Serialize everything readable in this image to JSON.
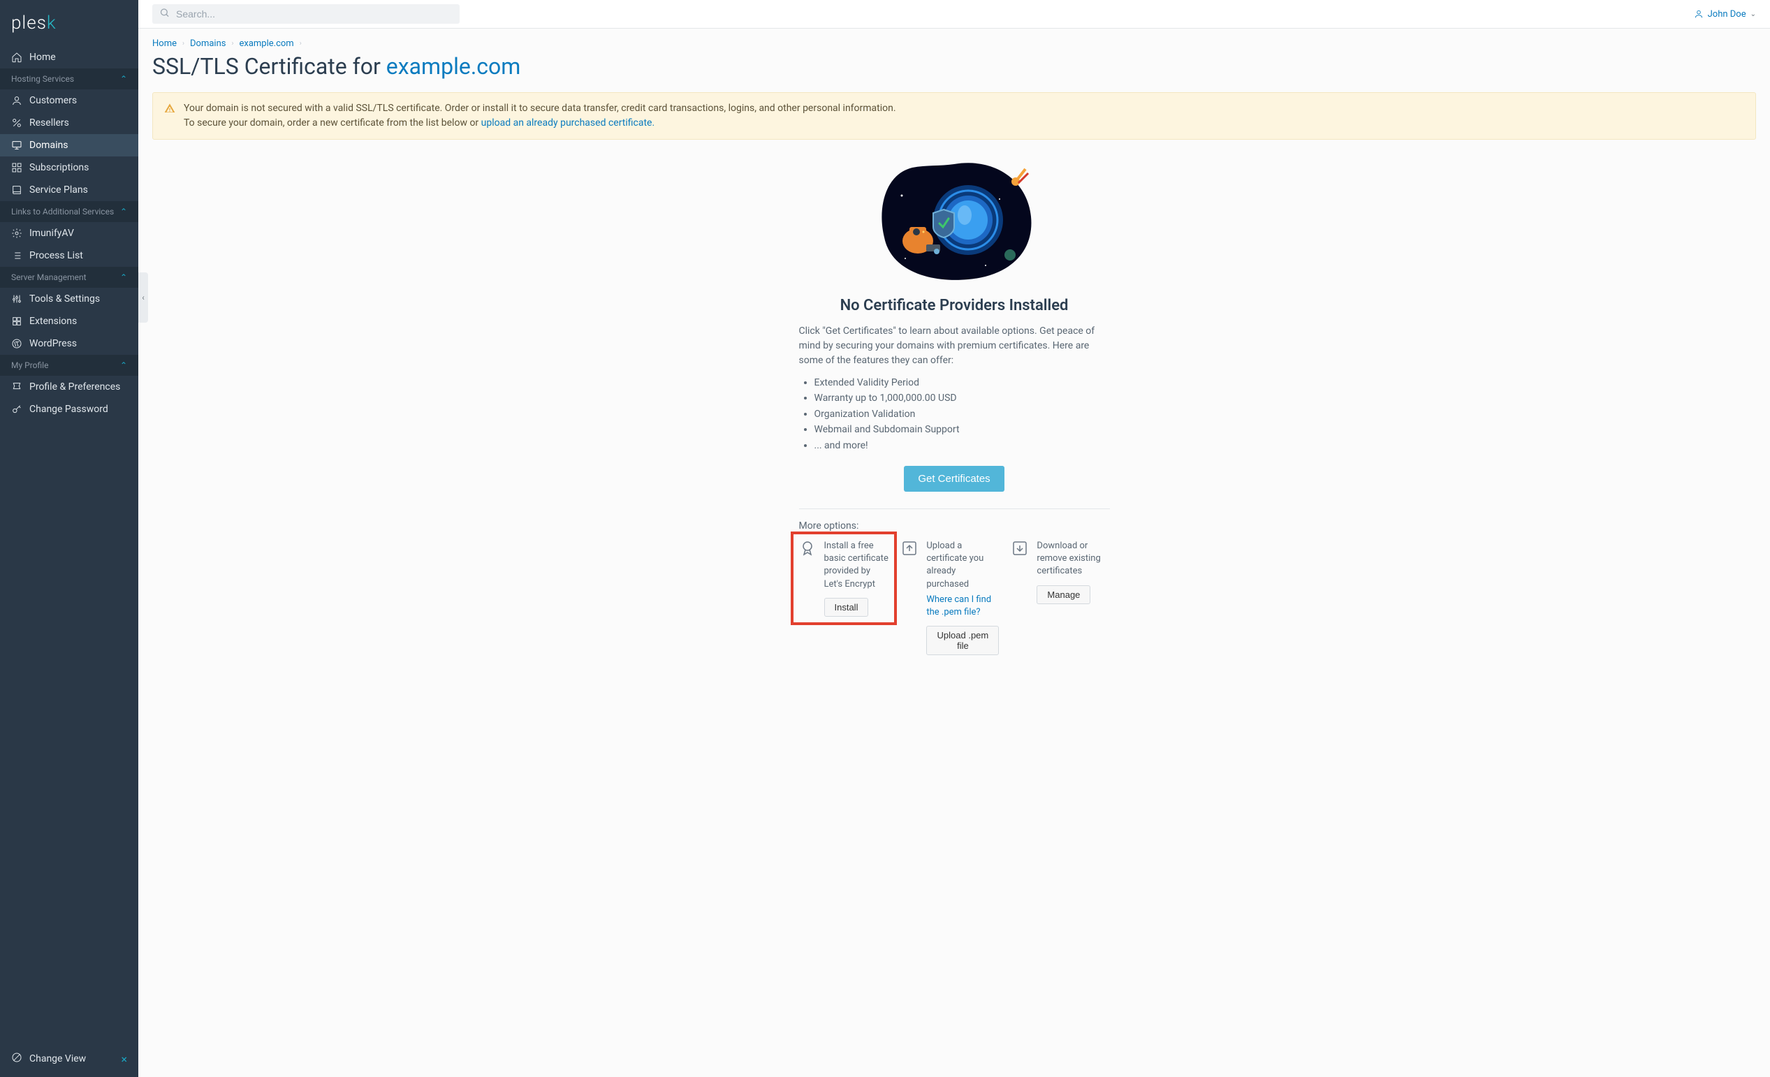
{
  "logo": {
    "text": "plesk"
  },
  "search": {
    "placeholder": "Search..."
  },
  "user": {
    "name": "John Doe"
  },
  "sidebar": {
    "top": {
      "label": "Home"
    },
    "groups": [
      {
        "label": "Hosting Services",
        "items": [
          {
            "label": "Customers"
          },
          {
            "label": "Resellers"
          },
          {
            "label": "Domains",
            "active": true
          },
          {
            "label": "Subscriptions"
          },
          {
            "label": "Service Plans"
          }
        ]
      },
      {
        "label": "Links to Additional Services",
        "items": [
          {
            "label": "ImunifyAV"
          },
          {
            "label": "Process List"
          }
        ]
      },
      {
        "label": "Server Management",
        "items": [
          {
            "label": "Tools & Settings"
          },
          {
            "label": "Extensions"
          },
          {
            "label": "WordPress"
          }
        ]
      },
      {
        "label": "My Profile",
        "items": [
          {
            "label": "Profile & Preferences"
          },
          {
            "label": "Change Password"
          }
        ]
      }
    ],
    "footer": {
      "label": "Change View"
    }
  },
  "breadcrumb": [
    {
      "label": "Home"
    },
    {
      "label": "Domains"
    },
    {
      "label": "example.com"
    }
  ],
  "page_title": {
    "prefix": "SSL/TLS Certificate for ",
    "domain": "example.com"
  },
  "alert": {
    "text1": "Your domain is not secured with a valid SSL/TLS certificate. Order or install it to secure data transfer, credit card transactions, logins, and other personal information.",
    "text2": "To secure your domain, order a new certificate from the list below or ",
    "link": "upload an already purchased certificate.",
    "suffix": ""
  },
  "hero": {
    "heading": "No Certificate Providers Installed",
    "paragraph": "Click \"Get Certificates\" to learn about available options. Get peace of mind by securing your domains with premium certificates. Here are some of the features they can offer:",
    "bullets": [
      "Extended Validity Period",
      "Warranty up to 1,000,000.00 USD",
      "Organization Validation",
      "Webmail and Subdomain Support",
      "... and more!"
    ],
    "cta": "Get Certificates"
  },
  "more_options": {
    "label": "More options:",
    "cards": [
      {
        "text": "Install a free basic certificate provided by Let's Encrypt",
        "button": "Install"
      },
      {
        "text": "Upload a certificate you already purchased",
        "link": "Where can I find the .pem file?",
        "button": "Upload .pem file"
      },
      {
        "text": "Download or remove existing certificates",
        "button": "Manage"
      }
    ]
  }
}
